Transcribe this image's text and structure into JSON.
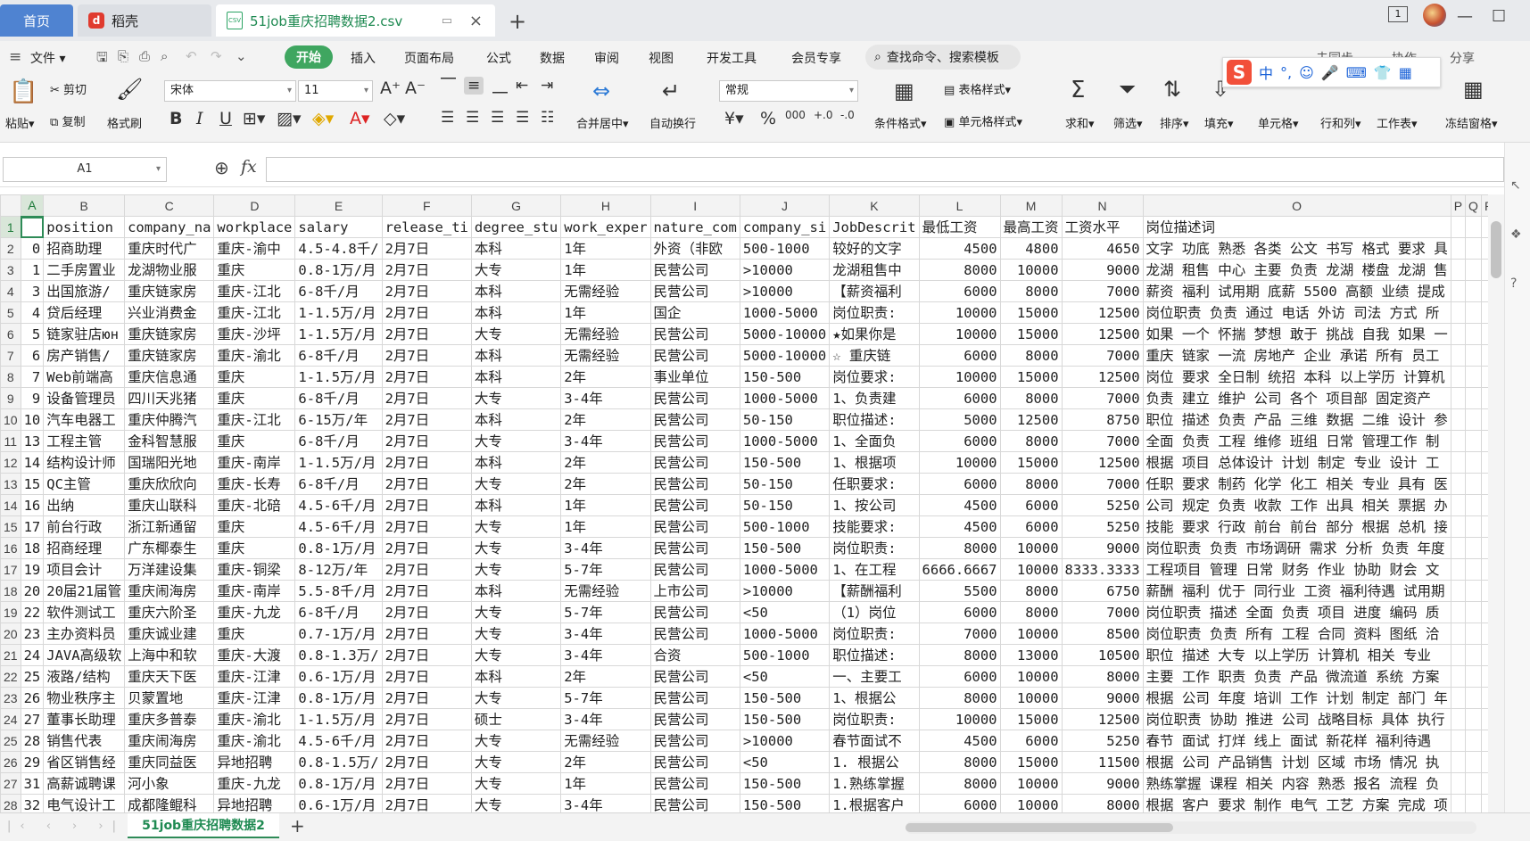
{
  "titlebar": {
    "home_tab": "首页",
    "app_tab": "稻壳",
    "file_tab": "51job重庆招聘数据2.csv",
    "csv_label": "CSV",
    "close": "×",
    "add": "+",
    "badge": "1"
  },
  "menu": {
    "file": "文件",
    "start": "开始",
    "items": [
      "插入",
      "页面布局",
      "公式",
      "数据",
      "审阅",
      "视图",
      "开发工具",
      "会员专享"
    ],
    "search": "查找命令、搜索模板",
    "right": [
      "未同步",
      "协作",
      "分享"
    ]
  },
  "ribbon": {
    "paste": "粘贴",
    "cut": "剪切",
    "copy": "复制",
    "format_painter": "格式刷",
    "font_name": "宋体",
    "font_size": "11",
    "merge_center": "合并居中",
    "wrap_text": "自动换行",
    "number_format": "常规",
    "conditional_format": "条件格式",
    "table_style": "表格样式",
    "cell_style": "单元格样式",
    "sum": "求和",
    "filter": "筛选",
    "sort": "排序",
    "fill": "填充",
    "cells": "单元格",
    "rows_cols": "行和列",
    "worksheet": "工作表",
    "freeze": "冻结窗格",
    "ime_chars": [
      "中",
      "°,",
      "☺",
      "🎤",
      "⌨",
      "👕",
      "▦"
    ]
  },
  "formula_bar": {
    "name_box": "A1",
    "fx": "fx",
    "formula": ""
  },
  "columns": [
    "A",
    "B",
    "C",
    "D",
    "E",
    "F",
    "G",
    "H",
    "I",
    "J",
    "K",
    "L",
    "M",
    "N",
    "O",
    "P",
    "Q",
    "R"
  ],
  "rows": [
    [
      "",
      "position",
      "company_na",
      "workplace",
      "salary",
      "release_ti",
      "degree_stu",
      "work_exper",
      "nature_com",
      "company_si",
      "JobDescrit",
      "最低工资",
      "最高工资",
      "工资水平",
      "岗位描述词",
      "",
      "",
      ""
    ],
    [
      "0",
      "招商助理",
      "重庆时代广",
      "重庆-渝中",
      "4.5-4.8千/",
      "2月7日",
      "本科",
      "1年",
      "外资（非欧",
      "500-1000",
      "较好的文字",
      "4500",
      "4800",
      "4650",
      "文字 功底 熟悉 各类 公文 书写 格式 要求 具",
      "",
      "",
      ""
    ],
    [
      "1",
      "二手房置业",
      "龙湖物业服",
      "重庆",
      "0.8-1万/月",
      "2月7日",
      "大专",
      "1年",
      "民营公司",
      ">10000",
      "龙湖租售中",
      "8000",
      "10000",
      "9000",
      "龙湖 租售 中心 主要 负责 龙湖 楼盘 龙湖 售",
      "",
      "",
      ""
    ],
    [
      "3",
      "出国旅游/",
      "重庆链家房",
      "重庆-江北",
      "6-8千/月",
      "2月7日",
      "本科",
      "无需经验",
      "民营公司",
      ">10000",
      "【薪资福利",
      "6000",
      "8000",
      "7000",
      "薪资 福利 试用期 底薪 5500 高额 业绩 提成",
      "",
      "",
      ""
    ],
    [
      "4",
      "贷后经理",
      "兴业消费金",
      "重庆-江北",
      "1-1.5万/月",
      "2月7日",
      "本科",
      "1年",
      "国企",
      "1000-5000",
      "岗位职责:",
      "10000",
      "15000",
      "12500",
      "岗位职责 负责 通过 电话 外访 司法 方式 所",
      "",
      "",
      ""
    ],
    [
      "5",
      "链家驻店юн",
      "重庆链家房",
      "重庆-沙坪",
      "1-1.5万/月",
      "2月7日",
      "大专",
      "无需经验",
      "民营公司",
      "5000-10000",
      "★如果你是",
      "10000",
      "15000",
      "12500",
      "如果 一个 怀揣 梦想 敢于 挑战 自我 如果 一",
      "",
      "",
      ""
    ],
    [
      "6",
      "房产销售/",
      "重庆链家房",
      "重庆-渝北",
      "6-8千/月",
      "2月7日",
      "本科",
      "无需经验",
      "民营公司",
      "5000-10000",
      "☆ 重庆链",
      "6000",
      "8000",
      "7000",
      "重庆 链家 一流 房地产 企业 承诺 所有 员工",
      "",
      "",
      ""
    ],
    [
      "7",
      "Web前端高",
      "重庆信息通",
      "重庆",
      "1-1.5万/月",
      "2月7日",
      "本科",
      "2年",
      "事业单位",
      "150-500",
      "岗位要求:",
      "10000",
      "15000",
      "12500",
      "岗位 要求 全日制 统招 本科 以上学历 计算机",
      "",
      "",
      ""
    ],
    [
      "9",
      "设备管理员",
      "四川天兆猪",
      "重庆",
      "6-8千/月",
      "2月7日",
      "大专",
      "3-4年",
      "民营公司",
      "1000-5000",
      "1、负责建",
      "6000",
      "8000",
      "7000",
      "负责 建立 维护 公司 各个 项目部 固定资产",
      "",
      "",
      ""
    ],
    [
      "10",
      "汽车电器工",
      "重庆仲腾汽",
      "重庆-江北",
      "6-15万/年",
      "2月7日",
      "本科",
      "2年",
      "民营公司",
      "50-150",
      "职位描述:",
      "5000",
      "12500",
      "8750",
      "职位 描述 负责 产品 三维 数据 二维 设计 参",
      "",
      "",
      ""
    ],
    [
      "13",
      "工程主管",
      "金科智慧服",
      "重庆",
      "6-8千/月",
      "2月7日",
      "大专",
      "3-4年",
      "民营公司",
      "1000-5000",
      "1、全面负",
      "6000",
      "8000",
      "7000",
      "全面 负责 工程 维修 班组 日常 管理工作 制",
      "",
      "",
      ""
    ],
    [
      "14",
      "结构设计师",
      "国瑞阳光地",
      "重庆-南岸",
      "1-1.5万/月",
      "2月7日",
      "本科",
      "2年",
      "民营公司",
      "150-500",
      "1、根据项",
      "10000",
      "15000",
      "12500",
      "根据 项目 总体设计 计划 制定 专业 设计 工",
      "",
      "",
      ""
    ],
    [
      "15",
      "QC主管",
      "重庆欣欣向",
      "重庆-长寿",
      "6-8千/月",
      "2月7日",
      "大专",
      "2年",
      "民营公司",
      "50-150",
      "任职要求:",
      "6000",
      "8000",
      "7000",
      "任职 要求 制药 化学 化工 相关 专业 具有 医",
      "",
      "",
      ""
    ],
    [
      "16",
      "出纳",
      "重庆山联科",
      "重庆-北碚",
      "4.5-6千/月",
      "2月7日",
      "本科",
      "1年",
      "民营公司",
      "50-150",
      "1、按公司",
      "4500",
      "6000",
      "5250",
      "公司 规定 负责 收款 工作 出具 相关 票据 办",
      "",
      "",
      ""
    ],
    [
      "17",
      "前台行政",
      "浙江新通留",
      "重庆",
      "4.5-6千/月",
      "2月7日",
      "大专",
      "1年",
      "民营公司",
      "500-1000",
      "技能要求:",
      "4500",
      "6000",
      "5250",
      "技能 要求 行政 前台 前台 部分 根据 总机 接",
      "",
      "",
      ""
    ],
    [
      "18",
      "招商经理",
      "广东椰泰生",
      "重庆",
      "0.8-1万/月",
      "2月7日",
      "大专",
      "3-4年",
      "民营公司",
      "150-500",
      "岗位职责:",
      "8000",
      "10000",
      "9000",
      "岗位职责 负责 市场调研 需求 分析 负责 年度",
      "",
      "",
      ""
    ],
    [
      "19",
      "项目会计",
      "万洋建设集",
      "重庆-铜梁",
      "8-12万/年",
      "2月7日",
      "大专",
      "5-7年",
      "民营公司",
      "1000-5000",
      "1、在工程",
      "6666.6667",
      "10000",
      "8333.3333",
      "工程项目 管理 日常 财务 作业 协助 财会 文",
      "",
      "",
      ""
    ],
    [
      "20",
      "20届21届管",
      "重庆闹海房",
      "重庆-南岸",
      "5.5-8千/月",
      "2月7日",
      "本科",
      "无需经验",
      "上市公司",
      ">10000",
      "【薪酬福利",
      "5500",
      "8000",
      "6750",
      "薪酬 福利 优于 同行业 工资 福利待遇 试用期",
      "",
      "",
      ""
    ],
    [
      "22",
      "软件测试工",
      "重庆六阶圣",
      "重庆-九龙",
      "6-8千/月",
      "2月7日",
      "大专",
      "5-7年",
      "民营公司",
      "<50",
      "（1）岗位",
      "6000",
      "8000",
      "7000",
      "岗位职责 描述 全面 负责 项目 进度 编码 质",
      "",
      "",
      ""
    ],
    [
      "23",
      "主办资料员",
      "重庆诚业建",
      "重庆",
      "0.7-1万/月",
      "2月7日",
      "大专",
      "3-4年",
      "民营公司",
      "1000-5000",
      "岗位职责:",
      "7000",
      "10000",
      "8500",
      "岗位职责 负责 所有 工程 合同 资料 图纸 洽",
      "",
      "",
      ""
    ],
    [
      "24",
      "JAVA高级软",
      "上海中和软",
      "重庆-大渡",
      "0.8-1.3万/",
      "2月7日",
      "大专",
      "3-4年",
      "合资",
      "500-1000",
      "职位描述:",
      "8000",
      "13000",
      "10500",
      "职位 描述 大专 以上学历 计算机 相关 专业",
      "",
      "",
      ""
    ],
    [
      "25",
      "液路/结构",
      "重庆天下医",
      "重庆-江津",
      "0.6-1万/月",
      "2月7日",
      "本科",
      "2年",
      "民营公司",
      "<50",
      "一、主要工",
      "6000",
      "10000",
      "8000",
      "主要 工作 职责 负责 产品 微流道 系统 方案",
      "",
      "",
      ""
    ],
    [
      "26",
      "物业秩序主",
      "贝蒙置地",
      "重庆-江津",
      "0.8-1万/月",
      "2月7日",
      "大专",
      "5-7年",
      "民营公司",
      "150-500",
      "1、根据公",
      "8000",
      "10000",
      "9000",
      "根据 公司 年度 培训 工作 计划 制定 部门 年",
      "",
      "",
      ""
    ],
    [
      "27",
      "董事长助理",
      "重庆多普泰",
      "重庆-渝北",
      "1-1.5万/月",
      "2月7日",
      "硕士",
      "3-4年",
      "民营公司",
      "150-500",
      "岗位职责:",
      "10000",
      "15000",
      "12500",
      "岗位职责 协助 推进 公司 战略目标 具体 执行",
      "",
      "",
      ""
    ],
    [
      "28",
      "销售代表",
      "重庆闹海房",
      "重庆-渝北",
      "4.5-6千/月",
      "2月7日",
      "大专",
      "无需经验",
      "民营公司",
      ">10000",
      "春节面试不",
      "4500",
      "6000",
      "5250",
      "春节 面试 打烊 线上 面试 新花样 福利待遇",
      "",
      "",
      ""
    ],
    [
      "29",
      "省区销售经",
      "重庆同益医",
      "异地招聘",
      "0.8-1.5万/",
      "2月7日",
      "大专",
      "2年",
      "民营公司",
      "<50",
      "1. 根据公",
      "8000",
      "15000",
      "11500",
      "根据 公司 产品销售 计划 区域 市场 情况 执",
      "",
      "",
      ""
    ],
    [
      "31",
      "高薪诚聘课",
      "河小象",
      "重庆-九龙",
      "0.8-1万/月",
      "2月7日",
      "大专",
      "1年",
      "民营公司",
      "150-500",
      "1.熟练掌握",
      "8000",
      "10000",
      "9000",
      "熟练掌握 课程 相关 内容 熟悉 报名 流程 负",
      "",
      "",
      ""
    ],
    [
      "32",
      "电气设计工",
      "成都隆鲲科",
      "异地招聘",
      "0.6-1万/月",
      "2月7日",
      "大专",
      "3-4年",
      "民营公司",
      "150-500",
      "1.根据客户",
      "6000",
      "10000",
      "8000",
      "根据 客户 要求 制作 电气 工艺 方案 完成 项",
      "",
      "",
      ""
    ]
  ],
  "numeric_columns": [
    0,
    11,
    12,
    13
  ],
  "bottom": {
    "sheet_tab": "51job重庆招聘数据2",
    "add_sheet": "+"
  }
}
